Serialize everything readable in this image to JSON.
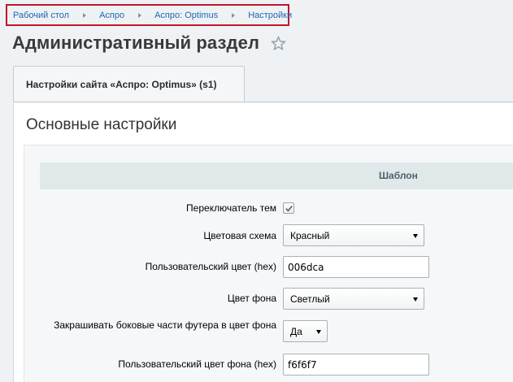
{
  "breadcrumb": [
    "Рабочий стол",
    "Аспро",
    "Аспро: Optimus",
    "Настройки"
  ],
  "page": {
    "title": "Административный раздел"
  },
  "tab": {
    "label": "Настройки сайта «Аспро: Optimus» (s1)"
  },
  "section": {
    "title": "Основные настройки",
    "header": "Шаблон"
  },
  "form": {
    "theme_switch_label": "Переключатель тем",
    "theme_switch_checked": true,
    "color_scheme_label": "Цветовая схема",
    "color_scheme_value": "Красный",
    "custom_color_label": "Пользовательский цвет (hex)",
    "custom_color_value": "006dca",
    "bg_color_label": "Цвет фона",
    "bg_color_value": "Светлый",
    "footer_sides_label": "Закрашивать боковые части футера в цвет фона",
    "footer_sides_value": "Да",
    "custom_bg_color_label": "Пользовательский цвет фона (hex)",
    "custom_bg_color_value": "f6f6f7"
  },
  "colors": {
    "breadcrumb_border": "#c0152a",
    "link": "#2067b0",
    "header_bg": "#e0e8ea"
  },
  "icons": {
    "favorite": "star-icon",
    "checkbox": "checkmark-icon",
    "dropdown": "chevron-down-icon"
  }
}
